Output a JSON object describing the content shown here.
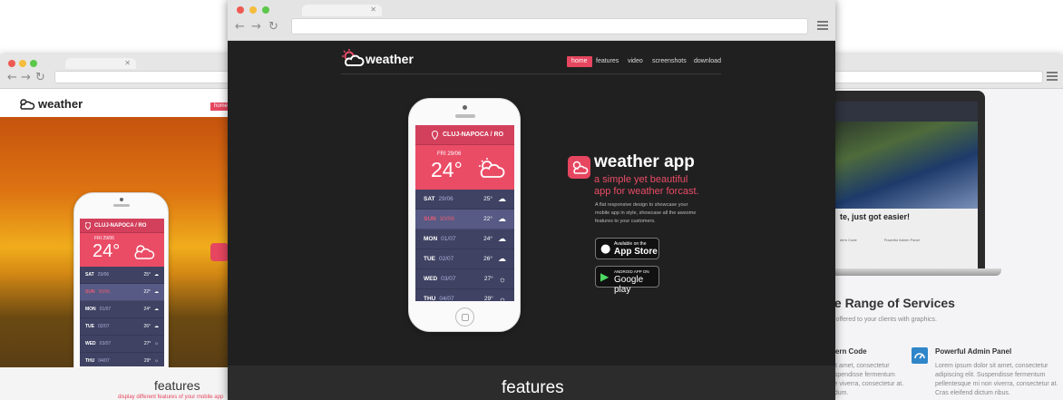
{
  "colors": {
    "accent": "#ea4c66",
    "accent_dark": "#d3405c",
    "screen_bg": "#3f4263",
    "dark_bg": "#202020"
  },
  "brand": {
    "name": "weather",
    "icon": "cloud-sun-icon"
  },
  "nav": {
    "items": [
      "home",
      "features",
      "video",
      "screenshots",
      "download"
    ],
    "active": "home"
  },
  "weather": {
    "location": "CLUJ-NAPOCA / RO",
    "today": "FRI 29/06",
    "temperature": "24°",
    "forecast": [
      {
        "day": "SAT",
        "date": "29/06",
        "temp": "25°",
        "icon": "cloud-icon"
      },
      {
        "day": "SUN",
        "date": "30/06",
        "temp": "22°",
        "icon": "cloud-icon",
        "selected": true
      },
      {
        "day": "MON",
        "date": "01/07",
        "temp": "24°",
        "icon": "cloud-icon"
      },
      {
        "day": "TUE",
        "date": "02/07",
        "temp": "26°",
        "icon": "cloud-icon"
      },
      {
        "day": "WED",
        "date": "03/07",
        "temp": "27°",
        "icon": "sun-icon"
      },
      {
        "day": "THU",
        "date": "04/07",
        "temp": "29°",
        "icon": "sun-icon"
      }
    ]
  },
  "hero": {
    "title": "weather app",
    "tagline_1": "a simple yet beautiful",
    "tagline_2": "app for weather forcast.",
    "desc_1": "A flat responsive design to showcase your",
    "desc_2": "mobile app in style, showcase all the awsome",
    "desc_3": "features to your customers.",
    "appstore_small": "Available on the",
    "appstore_big": "App Store",
    "googleplay_small": "ANDROID APP ON",
    "googleplay_big": "Google play"
  },
  "features": {
    "title": "features",
    "subtitle": "display different features of your mobile app"
  },
  "right": {
    "headline": "te, just got easier!",
    "section_title": "le Range of Services",
    "section_sub": "s offered to your clients with graphics.",
    "feat1_title": "dern Code",
    "feat1_label": "dern Code",
    "feat2_title": "Powerful Admin Panel",
    "feat2_label": "Powerful Admin Panel",
    "lorem_1": "sit amet, consectetur",
    "lorem_2": "uspendisse fermentum",
    "lorem_3": "ve viverra, consectetur at.",
    "lorem_4": "ndum.",
    "lorem2_1": "Lorem ipsum dolor sit amet, consectetur",
    "lorem2_2": "adipiscing elit. Suspendisse fermentum",
    "lorem2_3": "pellentesque mi non viverra, consectetur at.",
    "lorem2_4": "Cras eleifend dictum ribus."
  }
}
